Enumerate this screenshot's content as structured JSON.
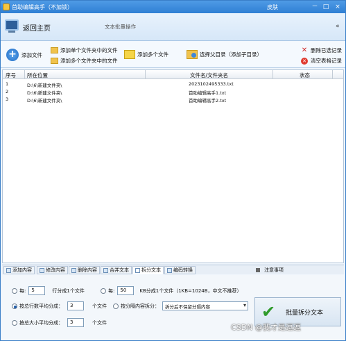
{
  "window": {
    "title": "首助编辑高手（不加锁）",
    "skin_label": "皮肤",
    "min_label": "－",
    "max_label": "□",
    "close_label": "×"
  },
  "header": {
    "home_label": "返回主页",
    "subtitle": "文本批量操作",
    "collapse_label": "«"
  },
  "toolbar": {
    "add_file": "添加文件",
    "add_single_folder": "添加单个文件夹中的文件",
    "add_multi_folders": "添加多个文件夹中的文件",
    "add_multi_files": "添加多个文件",
    "choose_parent": "选择父目录（添加子目录）",
    "delete_selected": "删除已选记录",
    "clear_table": "清空表格记录"
  },
  "table": {
    "headers": [
      "序号",
      "所在位置",
      "文件名/文件夹名",
      "状态"
    ],
    "rows": [
      {
        "index": "1",
        "location": "D:\\6\\新建文件夹\\",
        "name": "2023102495333.txt",
        "status": ""
      },
      {
        "index": "2",
        "location": "D:\\6\\新建文件夹\\",
        "name": "首助编辑高手1.txt",
        "status": ""
      },
      {
        "index": "3",
        "location": "D:\\6\\新建文件夹\\",
        "name": "首助编辑高手2.txt",
        "status": ""
      }
    ]
  },
  "tabs": [
    {
      "label": "添加内容",
      "active": false
    },
    {
      "label": "修改内容",
      "active": false
    },
    {
      "label": "删除内容",
      "active": false
    },
    {
      "label": "合并文本",
      "active": false
    },
    {
      "label": "拆分文本",
      "active": true
    },
    {
      "label": "编码转换",
      "active": false
    }
  ],
  "notice_label": "注意事项",
  "split": {
    "every_lines_prefix": "每:",
    "every_lines_value": "5",
    "every_lines_suffix": "行分成1个文件",
    "every_kb_prefix": "每:",
    "every_kb_value": "50",
    "every_kb_suffix": "KB分成1个文件（1KB=1024B，中文不推荐）",
    "by_total_lines": "按总行数平均分成：",
    "by_total_lines_value": "3",
    "files_suffix_1": "个文件",
    "by_separator": "按分隔内容拆分：",
    "separator_option": "拆分后不保留分隔内容",
    "by_total_size": "按总大小平均分成：",
    "by_total_size_value": "3",
    "files_suffix_2": "个文件",
    "run_button": "批量拆分文本"
  },
  "watermark": "CSDN @我才是逗逗"
}
